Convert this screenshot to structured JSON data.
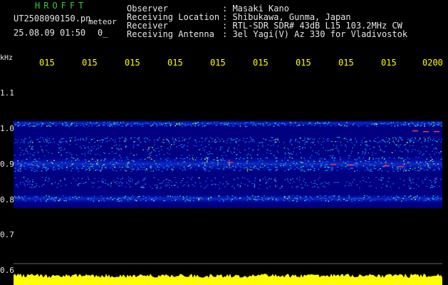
{
  "header": {
    "brand": "HROFFT",
    "filename": "UT2508090150.pn",
    "filename_suffix": "meteor",
    "datetime": "25.08.09 01:50",
    "datetime_extra": "0_",
    "fields": [
      {
        "label": "Observer",
        "value": ": Masaki Kano"
      },
      {
        "label": "Receiving Location",
        "value": ": Shibukawa, Gunma, Japan"
      },
      {
        "label": "Receiver",
        "value": ": RTL-SDR SDR# 43dB L15 103.2MHz CW"
      },
      {
        "label": "Receiving Antenna",
        "value": ": 3el Yagi(V) Az 330 for Vladivostok"
      }
    ]
  },
  "axis": {
    "unit": "kHz",
    "x_ticks": [
      "015",
      "015",
      "015",
      "015",
      "015",
      "015",
      "015",
      "015",
      "015",
      "0200"
    ],
    "y_ticks": [
      "1.1",
      "1.0",
      "0.9",
      "0.8",
      "0.7",
      "0.6"
    ]
  },
  "colors": {
    "background": "#000000",
    "tick_color": "#ffff00",
    "brand_color": "#33cc33",
    "power_trace": "#ffff00"
  }
}
